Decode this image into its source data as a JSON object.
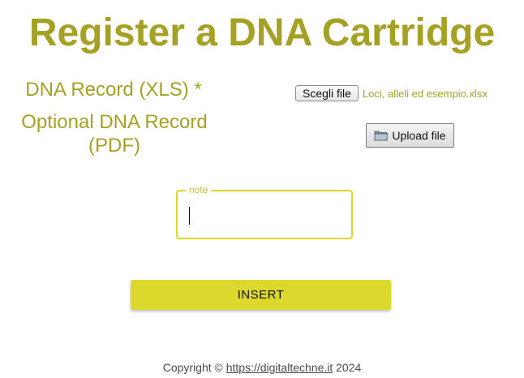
{
  "page": {
    "title": "Register a DNA Cartridge"
  },
  "form": {
    "xls_label": "DNA Record (XLS) *",
    "pdf_label": "Optional DNA Record (PDF)",
    "choose_file_label": "Scegli file",
    "chosen_file_name": "Loci, alleli ed esempio.xlsx",
    "upload_file_label": "Upload file",
    "note_legend": "note",
    "note_value": "",
    "insert_label": "INSERT"
  },
  "footer": {
    "copyright_prefix": "Copyright ©",
    "link_text": "https://digitaltechne.it",
    "year": "2024"
  },
  "colors": {
    "title": "#a5a125",
    "accent": "#dcd82e"
  },
  "icons": {
    "upload": "folder-icon"
  }
}
